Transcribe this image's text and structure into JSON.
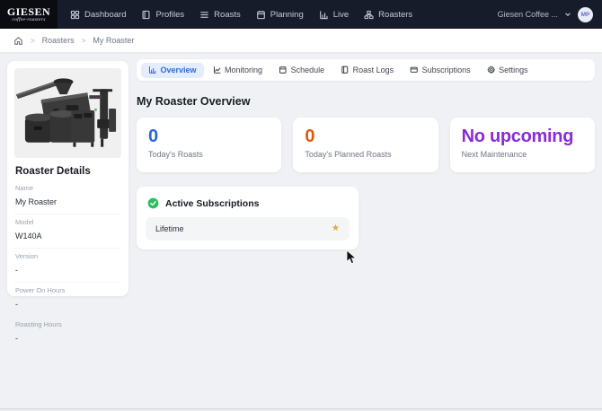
{
  "navbar": {
    "logo": {
      "title": "GIESEN",
      "subtitle": "coffee-roasters"
    },
    "items": [
      {
        "label": "Dashboard",
        "icon": "grid-icon"
      },
      {
        "label": "Profiles",
        "icon": "book-icon"
      },
      {
        "label": "Roasts",
        "icon": "list-icon"
      },
      {
        "label": "Planning",
        "icon": "calendar-icon"
      },
      {
        "label": "Live",
        "icon": "bar-chart-icon"
      },
      {
        "label": "Roasters",
        "icon": "sitemap-icon"
      }
    ],
    "account": {
      "label": "Giesen Coffee ...",
      "initials": "MP"
    }
  },
  "breadcrumb": {
    "items": [
      "Roasters",
      "My Roaster"
    ]
  },
  "tabs": [
    {
      "label": "Overview",
      "icon": "bar-chart-icon",
      "active": true
    },
    {
      "label": "Monitoring",
      "icon": "line-chart-icon",
      "active": false
    },
    {
      "label": "Schedule",
      "icon": "calendar-icon",
      "active": false
    },
    {
      "label": "Roast Logs",
      "icon": "book-icon",
      "active": false
    },
    {
      "label": "Subscriptions",
      "icon": "card-icon",
      "active": false
    },
    {
      "label": "Settings",
      "icon": "gear-icon",
      "active": false
    }
  ],
  "page": {
    "title": "My Roaster Overview"
  },
  "stats": [
    {
      "value": "0",
      "label": "Today's Roasts",
      "color": "#2E63D9"
    },
    {
      "value": "0",
      "label": "Today's Planned Roasts",
      "color": "#E2590E"
    },
    {
      "value": "No upcoming",
      "label": "Next Maintenance",
      "color": "#8A2BD9"
    }
  ],
  "subscriptions": {
    "title": "Active Subscriptions",
    "check_color": "#2DBE60",
    "items": [
      {
        "name": "Lifetime",
        "icon": "star-icon",
        "star_color": "#EDA430"
      }
    ]
  },
  "details": {
    "title": "Roaster Details",
    "fields": [
      {
        "label": "Name",
        "value": "My Roaster"
      },
      {
        "label": "Model",
        "value": "W140A"
      },
      {
        "label": "Version",
        "value": "-"
      },
      {
        "label": "Power On Hours",
        "value": "-"
      },
      {
        "label": "Roasting Hours",
        "value": "-"
      }
    ]
  }
}
